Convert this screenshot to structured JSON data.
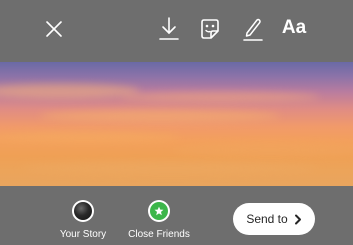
{
  "toolbar": {
    "close_icon": "close-icon",
    "download_icon": "download-icon",
    "sticker_icon": "sticker-icon",
    "draw_icon": "draw-icon",
    "text_label": "Aa"
  },
  "photo": {
    "content": "sunset sky",
    "colors": [
      "#6a6aa6",
      "#b97c9f",
      "#f19a6a",
      "#e9a55e"
    ]
  },
  "share": {
    "your_story_label": "Your Story",
    "close_friends_label": "Close Friends",
    "close_friends_color": "#3cb64a",
    "send_label": "Send to",
    "send_icon": "chevron-right-icon"
  }
}
